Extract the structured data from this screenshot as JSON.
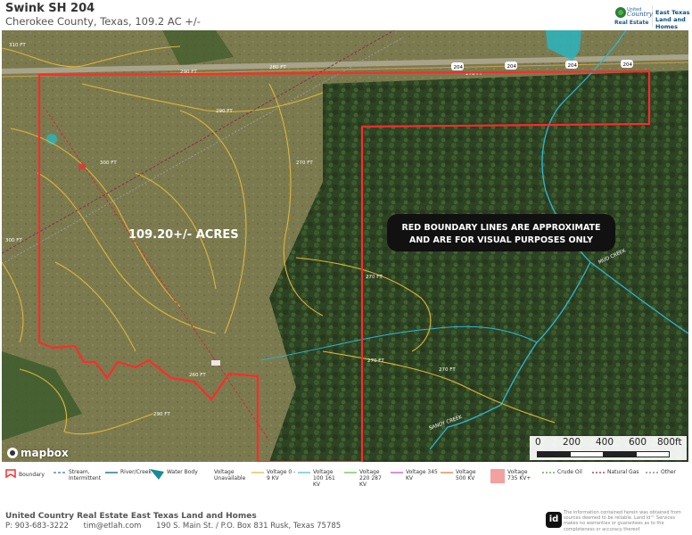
{
  "header": {
    "title": "Swink SH 204",
    "subtitle": "Cherokee County, Texas, 109.2 AC +/-",
    "brand_line1": "United",
    "brand_line2": "Country",
    "brand_line3": "Real Estate",
    "brand_right1": "East Texas",
    "brand_right2": "Land and Homes"
  },
  "map": {
    "acreage_label": "109.20+/- ACRES",
    "notice_line1": "RED BOUNDARY LINES ARE APPROXIMATE",
    "notice_line2": "AND ARE FOR VISUAL PURPOSES ONLY",
    "road_shield": "204",
    "creek_label": "MUD CREEK",
    "creek_label2": "SANDY CREEK",
    "contour_labels": [
      "310 FT",
      "300 FT",
      "290 FT",
      "280 FT",
      "270 FT",
      "260 FT"
    ],
    "attribution": "mapbox",
    "boundary_color": "#ff2b2b"
  },
  "scale": {
    "t0": "0",
    "t1": "200",
    "t2": "400",
    "t3": "600",
    "t4": "800ft"
  },
  "legend": {
    "boundary": "Boundary",
    "stream": "Stream, Intermittent",
    "river": "River/Creek",
    "water": "Water Body",
    "voltage_unavailable": "Voltage Unavailable",
    "v0_9": "Voltage 0 - 9 KV",
    "v100": "Voltage 100 161 KV",
    "v220": "Voltage 220 287 KV",
    "v345": "Voltage 345 KV",
    "v500": "Voltage 500 KV",
    "v735": "Voltage 735 KV+",
    "crude": "Crude Oil",
    "gas": "Natural Gas",
    "other": "Other"
  },
  "footer": {
    "company": "United Country Real Estate East Texas Land and Homes",
    "phone": "P: 903-683-3222",
    "email": "tim@etlah.com",
    "address": "190 S. Main St. / P.O. Box 831 Rusk, Texas 75785",
    "id_logo": "id",
    "disclaimer": "The information contained herein was obtained from sources deemed to be reliable. Land id™ Services makes no warranties or guarantees as to the completeness or accuracy thereof."
  }
}
